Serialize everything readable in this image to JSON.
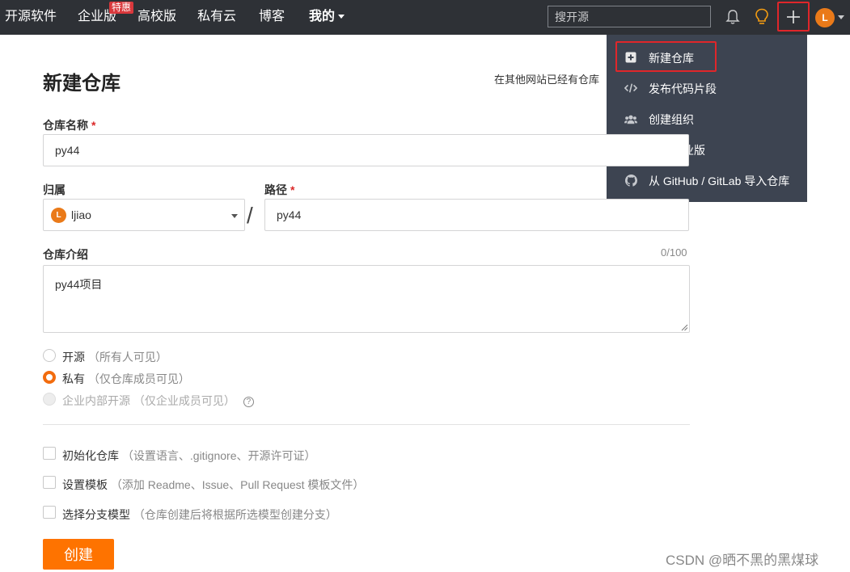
{
  "nav": {
    "items": [
      "开源软件",
      "企业版",
      "高校版",
      "私有云",
      "博客",
      "我的"
    ],
    "enterprise_badge": "特惠",
    "search_placeholder": "搜开源",
    "avatar_letter": "L"
  },
  "dropdown": {
    "items": [
      {
        "label": "新建仓库",
        "icon": "plus-square-icon"
      },
      {
        "label": "发布代码片段",
        "icon": "code-icon"
      },
      {
        "label": "创建组织",
        "icon": "users-icon"
      },
      {
        "label": "开通企业版",
        "icon": "building-icon"
      },
      {
        "label": "从 GitHub / GitLab 导入仓库",
        "icon": "github-icon"
      }
    ]
  },
  "form": {
    "title": "新建仓库",
    "import_hint": "在其他网站已经有仓库",
    "name_label": "仓库名称",
    "required_mark": "*",
    "name_value": "py44",
    "owner_label": "归属",
    "owner_value": "ljiao",
    "owner_avatar": "L",
    "separator": "/",
    "path_label": "路径",
    "path_value": "py44",
    "intro_label": "仓库介绍",
    "intro_counter": "0/100",
    "intro_value": "py44项目",
    "visibility": [
      {
        "label": "开源",
        "hint": "（所有人可见）",
        "state": "unchecked"
      },
      {
        "label": "私有",
        "hint": "（仅仓库成员可见）",
        "state": "checked"
      },
      {
        "label": "企业内部开源",
        "hint": "（仅企业成员可见）",
        "state": "disabled",
        "help": "?"
      }
    ],
    "options": [
      {
        "label": "初始化仓库",
        "hint": "（设置语言、.gitignore、开源许可证）"
      },
      {
        "label": "设置模板",
        "hint": "（添加 Readme、Issue、Pull Request 模板文件）"
      },
      {
        "label": "选择分支模型",
        "hint": "（仓库创建后将根据所选模型创建分支）"
      }
    ],
    "submit_label": "创建"
  },
  "watermark": "CSDN @晒不黑的黑煤球",
  "colors": {
    "topbar": "#2e3136",
    "dropdown": "#3d4451",
    "accent_orange": "#fe7300",
    "highlight_red": "#e0262a"
  }
}
